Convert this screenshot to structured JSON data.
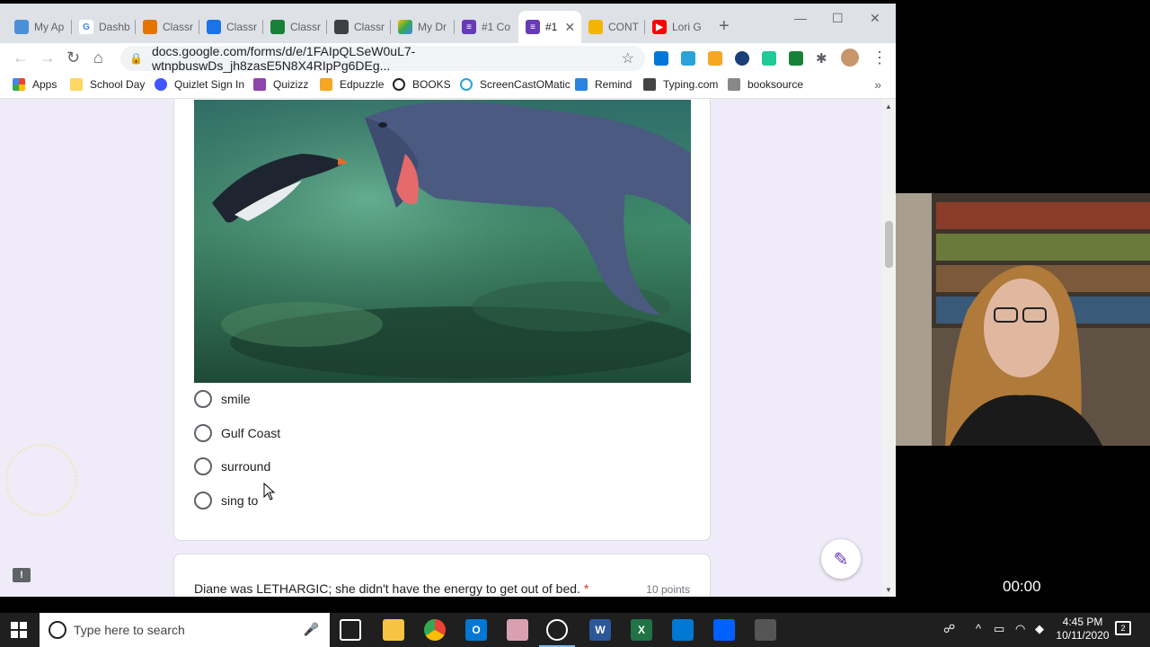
{
  "browser": {
    "tabs": [
      {
        "label": "My Ap",
        "color": "#4a90d9"
      },
      {
        "label": "Dashb",
        "color": "#4285f4"
      },
      {
        "label": "Classr",
        "color": "#e37400"
      },
      {
        "label": "Classr",
        "color": "#1a73e8"
      },
      {
        "label": "Classr",
        "color": "#188038"
      },
      {
        "label": "Classr",
        "color": "#3c4043"
      },
      {
        "label": "My Dr",
        "color": "#fbbc04"
      },
      {
        "label": "#1 Co",
        "color": "#673ab7"
      },
      {
        "label": "#1",
        "color": "#673ab7",
        "active": true
      },
      {
        "label": "CONT",
        "color": "#f4b400"
      },
      {
        "label": "Lori G",
        "color": "#ff0000"
      }
    ],
    "url": "docs.google.com/forms/d/e/1FAIpQLSeW0uL7-wtnpbuswDs_jh8zasE5N8X4RIpPg6DEg...",
    "bookmarks": [
      {
        "label": "Apps",
        "icon": "apps-grid-icon",
        "color": "#ea4335"
      },
      {
        "label": "School Day",
        "icon": "folder-icon",
        "color": "#fdd663"
      },
      {
        "label": "Quizlet Sign In",
        "icon": "quizlet-icon",
        "color": "#4255ff"
      },
      {
        "label": "Quizizz",
        "icon": "quizizz-icon",
        "color": "#8e44ad"
      },
      {
        "label": "Edpuzzle",
        "icon": "edpuzzle-icon",
        "color": "#f5a623"
      },
      {
        "label": "BOOKS",
        "icon": "circle-icon",
        "color": "#222222"
      },
      {
        "label": "ScreenCastOMatic",
        "icon": "screencast-icon",
        "color": "#2aa3d8"
      },
      {
        "label": "Remind",
        "icon": "remind-icon",
        "color": "#2a84e0"
      },
      {
        "label": "Typing.com",
        "icon": "typing-icon",
        "color": "#444444"
      },
      {
        "label": "booksource",
        "icon": "booksource-icon",
        "color": "#555555"
      }
    ]
  },
  "form": {
    "options": [
      "smile",
      "Gulf Coast",
      "surround",
      "sing to"
    ],
    "next_question": "Diane was LETHARGIC; she didn't have the energy to get out of bed.",
    "required_mark": "*",
    "next_points": "10 points"
  },
  "overlay": {
    "timer": "00:00"
  },
  "taskbar": {
    "search_placeholder": "Type here to search",
    "time": "4:45 PM",
    "date": "10/11/2020",
    "notification_count": "2"
  }
}
